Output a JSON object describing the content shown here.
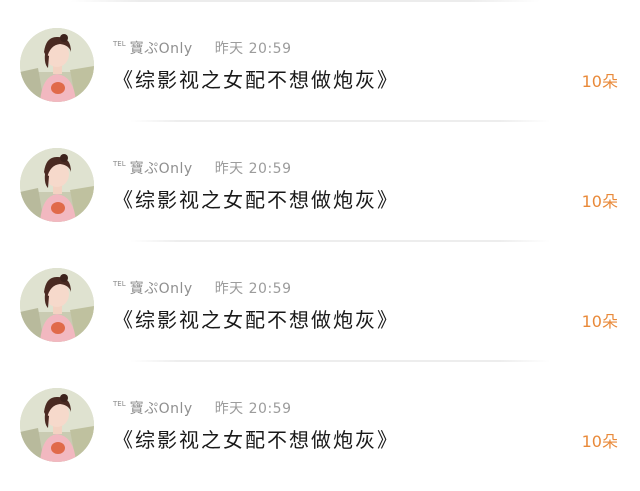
{
  "feed": {
    "items": [
      {
        "tel": "TEL",
        "username": "寶ぷOnly",
        "time": "昨天 20:59",
        "title": "《综影视之女配不想做炮灰》",
        "count": "10朵"
      },
      {
        "tel": "TEL",
        "username": "寶ぷOnly",
        "time": "昨天 20:59",
        "title": "《综影视之女配不想做炮灰》",
        "count": "10朵"
      },
      {
        "tel": "TEL",
        "username": "寶ぷOnly",
        "time": "昨天 20:59",
        "title": "《综影视之女配不想做炮灰》",
        "count": "10朵"
      },
      {
        "tel": "TEL",
        "username": "寶ぷOnly",
        "time": "昨天 20:59",
        "title": "《综影视之女配不想做炮灰》",
        "count": "10朵"
      }
    ]
  },
  "colors": {
    "count_accent": "#e98a3a",
    "meta_gray": "#9a9a9a",
    "title_text": "#1a1a1a"
  },
  "icons": {
    "avatar": "user-avatar-photo"
  }
}
